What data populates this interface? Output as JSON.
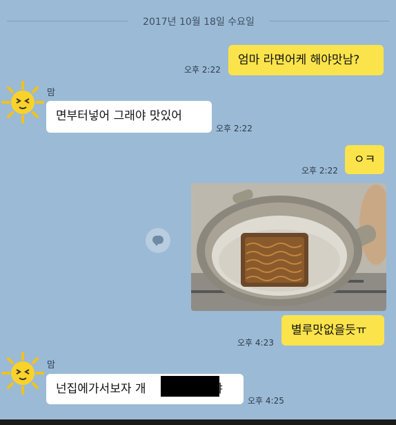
{
  "date_divider": "2017년 10월 18일 수요일",
  "contact_name": "맘",
  "messages": [
    {
      "sender": "me",
      "text": "엄마 라면어케 해야맛남?",
      "time": "오후 2:22"
    },
    {
      "sender": "mom",
      "text": "면부터넣어  그래야 맛있어",
      "time": "오후 2:22"
    },
    {
      "sender": "me",
      "text": "ㅇㅋ",
      "time": "오후 2:22"
    },
    {
      "sender": "me",
      "type": "photo",
      "photo_desc": "pot-with-ramen-icon"
    },
    {
      "sender": "me",
      "text": "별루맛없을듯ㅠ",
      "time": "오후 4:23"
    },
    {
      "sender": "mom",
      "text_before": "넌집에가서보자 개",
      "text_after": "이야",
      "time": "오후 4:25"
    }
  ],
  "colors": {
    "background": "#9bbad6",
    "my_bubble": "#fbe34b",
    "their_bubble": "#ffffff"
  }
}
